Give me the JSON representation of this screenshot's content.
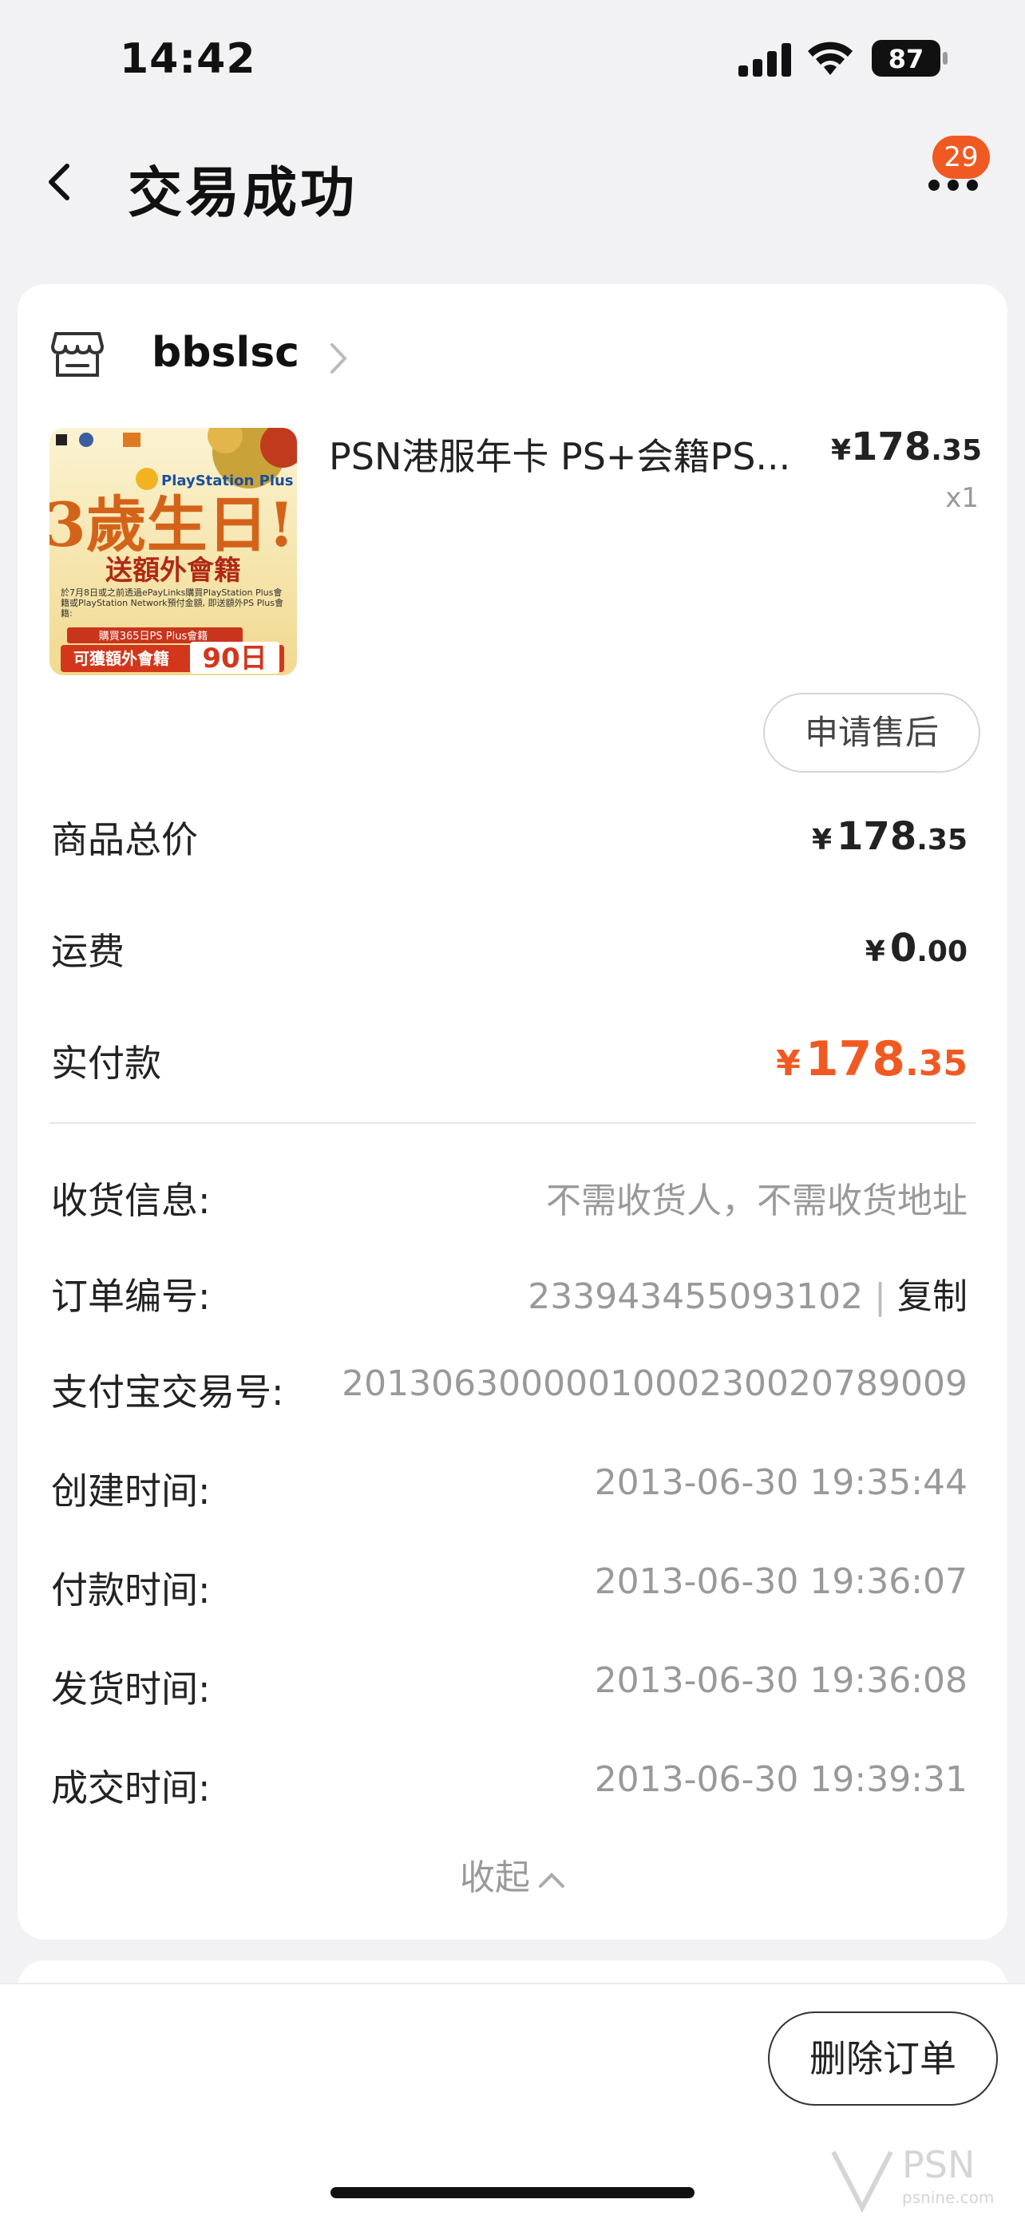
{
  "status_bar": {
    "time": "14:42",
    "battery": "87"
  },
  "nav": {
    "title": "交易成功",
    "badge": "29"
  },
  "shop": {
    "name": "bbslsc"
  },
  "product": {
    "title": "PSN港服年卡 PS+会籍PS...",
    "price_int": "178",
    "price_dec": ".35",
    "currency": "¥",
    "qty": "x1",
    "image": {
      "brand": "PlayStation Plus",
      "headline": "3歲生日!",
      "subhead": "送額外會籍",
      "fine_print": "於7月8日或之前透過ePayLinks購買PlayStation Plus會籍或PlayStation Network預付金額, 即送額外PS Plus會籍:",
      "bonus_line": "購買365日PS Plus會籍",
      "bonus_label": "可獲額外會籍",
      "bonus_days": "90日"
    }
  },
  "after_sale_label": "申请售后",
  "summary": {
    "goods_total": {
      "label": "商品总价",
      "int": "178",
      "dec": ".35"
    },
    "shipping": {
      "label": "运费",
      "int": "0",
      "dec": ".00"
    },
    "paid": {
      "label": "实付款",
      "int": "178",
      "dec": ".35"
    },
    "currency": "¥"
  },
  "info": {
    "receiver": {
      "label": "收货信息:",
      "value": "不需收货人，不需收货地址"
    },
    "order_no": {
      "label": "订单编号:",
      "value": "233943455093102",
      "sep": "|",
      "copy": "复制"
    },
    "alipay_no": {
      "label": "支付宝交易号:",
      "value": "2013063000001000230020789009"
    },
    "created": {
      "label": "创建时间:",
      "value": "2013-06-30 19:35:44"
    },
    "paid": {
      "label": "付款时间:",
      "value": "2013-06-30 19:36:07"
    },
    "shipped": {
      "label": "发货时间:",
      "value": "2013-06-30 19:36:08"
    },
    "closed": {
      "label": "成交时间:",
      "value": "2013-06-30 19:39:31"
    }
  },
  "collapse_label": "收起",
  "delete_label": "删除订单",
  "watermark": {
    "text": "PSN",
    "subtext": "psnine.com"
  },
  "colors": {
    "accent": "#f05a22",
    "background": "#f2f2f4"
  }
}
